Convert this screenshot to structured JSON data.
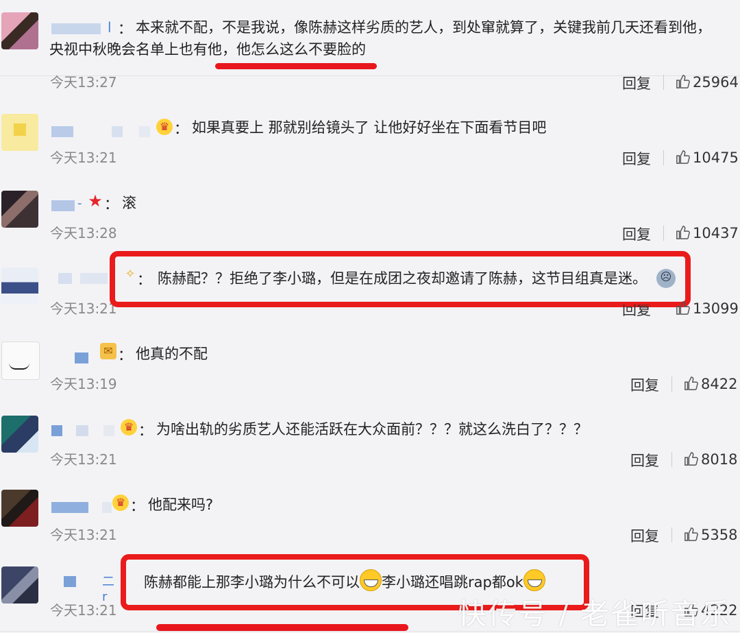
{
  "colors": {
    "background": "#f3f3f6",
    "accent_red": "#e8171d",
    "username_blue": "#c8d6ec",
    "time_gray": "#888888"
  },
  "comments": [
    {
      "name_suffix": "l",
      "text": "本来就不配，不是我说，像陈赫这样劣质的艺人，到处窜就算了，关键我前几天还看到他，央视中秋晚会名单上也有他，他怎么这么不要脸的",
      "time": "今天13:27",
      "reply": "回复",
      "likes": "25964"
    },
    {
      "text": "如果真要上 那就别给镜头了 让他好好坐在下面看节目吧",
      "time": "今天13:21",
      "reply": "回复",
      "likes": "10475"
    },
    {
      "text": "滚",
      "time": "今天13:28",
      "reply": "回复",
      "likes": "10437"
    },
    {
      "text": "陈赫配？？拒绝了李小璐，但是在成团之夜却邀请了陈赫，这节目组真是迷。",
      "time": "今天13:21",
      "reply": "回复",
      "likes": "13099"
    },
    {
      "text": "他真的不配",
      "time": "今天13:19",
      "reply": "回复",
      "likes": "8422"
    },
    {
      "text": "为啥出轨的劣质艺人还能活跃在大众面前？？？就这么洗白了？？？",
      "time": "今天13:21",
      "reply": "回复",
      "likes": "8018"
    },
    {
      "text": "他配来吗?",
      "time": "今天13:21",
      "reply": "回复",
      "likes": "5358"
    },
    {
      "text_part1": "陈赫都能上那李小璐为什么不可以",
      "text_part2": "李小璐还唱跳rap都ok",
      "time": "今天13:21",
      "reply": "回复",
      "likes": "4222"
    }
  ],
  "watermark": "快传号 / 老雀听音乐",
  "icons": {
    "like": "thumbs-up-icon",
    "crown": "crown-badge-icon",
    "star": "star-badge-icon",
    "grin": "grin-emoji-icon",
    "ghost": "ghost-emoji-icon"
  }
}
